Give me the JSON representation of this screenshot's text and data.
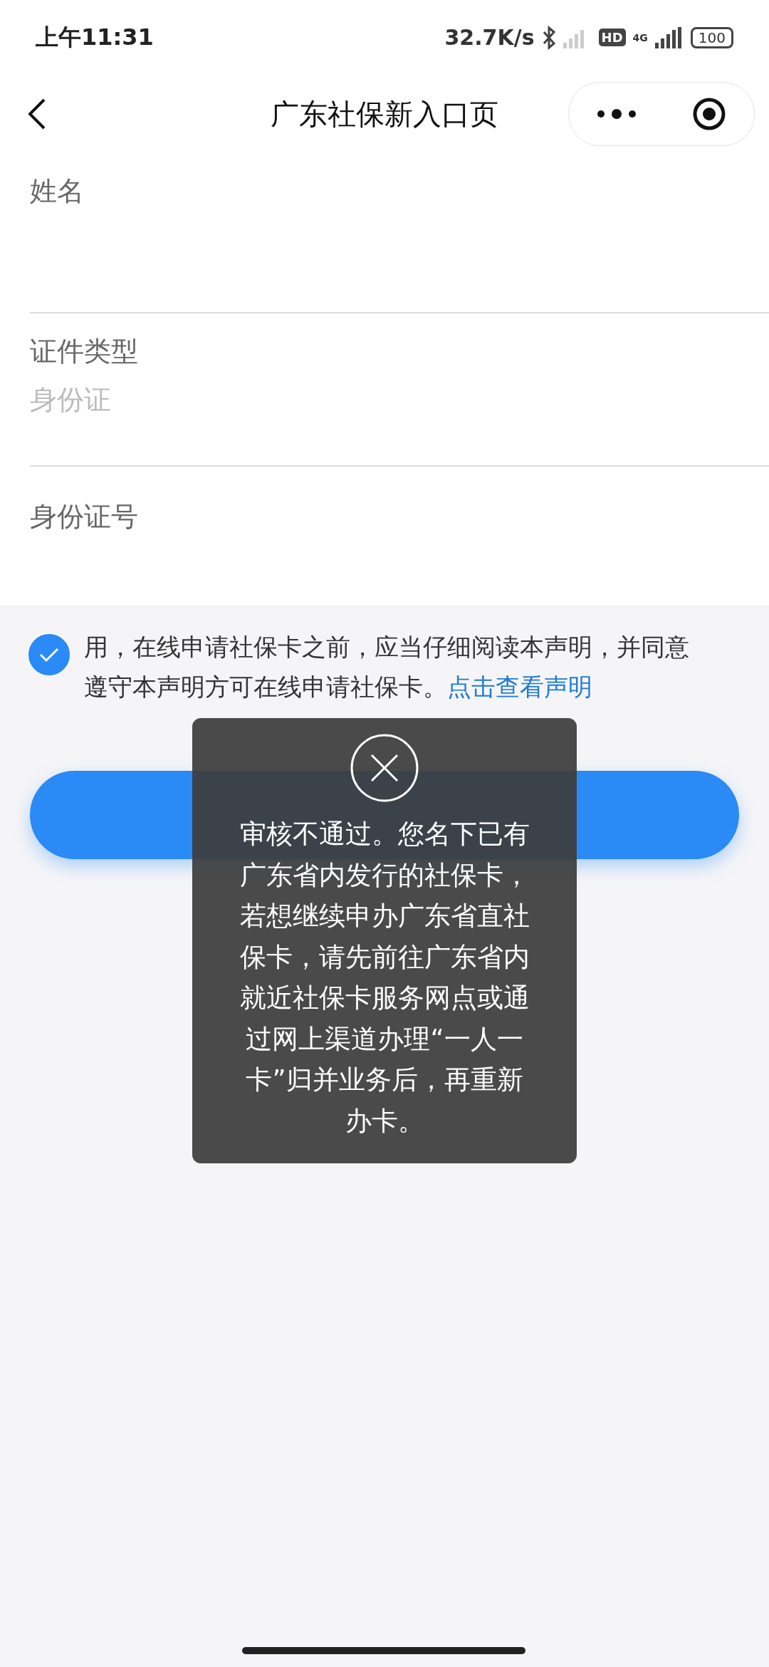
{
  "status_bar": {
    "time": "上午11:31",
    "speed": "32.7K/s",
    "hd": "HD",
    "network": "4G",
    "battery": "100"
  },
  "nav": {
    "title": "广东社保新入口页"
  },
  "form": {
    "fields": [
      {
        "label": "姓名"
      },
      {
        "label": "证件类型",
        "placeholder": "身份证"
      },
      {
        "label": "身份证号"
      }
    ]
  },
  "agreement": {
    "checked": true,
    "text": "用，在线申请社保卡之前，应当仔细阅读本声明，并同意遵守本声明方可在线申请社保卡。",
    "link": "点击查看声明"
  },
  "toast": {
    "message": "审核不通过。您名下已有广东省内发行的社保卡，若想继续申办广东省直社保卡，请先前往广东省内就近社保卡服务网点或通过网上渠道办理“一人一卡”归并业务后，再重新办卡。"
  }
}
